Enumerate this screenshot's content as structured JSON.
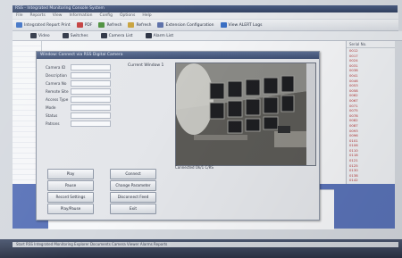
{
  "window": {
    "title": "RSS - Integrated Monitoring Console System"
  },
  "menu": [
    "File",
    "Reports",
    "View",
    "Information",
    "Config",
    "Options",
    "Help"
  ],
  "toolbar": [
    {
      "label": "Integrated Report Print",
      "icon": "print-icon",
      "color": "#3a6fc4"
    },
    {
      "label": "PDF",
      "icon": "pdf-icon",
      "color": "#c23b3b"
    },
    {
      "label": "Refresh",
      "icon": "refresh-icon",
      "color": "#4a8f3a"
    },
    {
      "label": "Refresh",
      "icon": "refresh-icon",
      "color": "#c8a23b"
    },
    {
      "label": "Extension Configuration",
      "icon": "settings-icon",
      "color": "#5b6fa8"
    },
    {
      "label": "View ALERT Logs",
      "icon": "log-icon",
      "color": "#3a6fc4"
    }
  ],
  "toolbar2": [
    {
      "label": "Video",
      "icon": "video-icon"
    },
    {
      "label": "Switches",
      "icon": "switch-icon"
    },
    {
      "label": "Camera List",
      "icon": "camera-icon"
    },
    {
      "label": "Alarm List",
      "icon": "alarm-icon"
    }
  ],
  "right_panel": {
    "header": "Serial No.",
    "ids": [
      "0012",
      "0017",
      "0024",
      "0031",
      "0038",
      "0041",
      "0046",
      "0053",
      "0058",
      "0062",
      "0067",
      "0071",
      "0075",
      "0078",
      "0082",
      "0087",
      "0093",
      "0096",
      "0101",
      "0106",
      "0110",
      "0118",
      "0121",
      "0125",
      "0130",
      "0138",
      "0142",
      "0147"
    ]
  },
  "dialog": {
    "title": "Window: Connect via RSS Digital Camera",
    "fields": [
      {
        "label": "Camera ID",
        "value": ""
      },
      {
        "label": "Description",
        "value": ""
      },
      {
        "label": "Camera No",
        "value": ""
      },
      {
        "label": "Remote Site",
        "value": ""
      },
      {
        "label": "Access Type",
        "value": ""
      },
      {
        "label": "Mode",
        "value": ""
      },
      {
        "label": "Status",
        "value": ""
      },
      {
        "label": "Patrons",
        "value": ""
      }
    ],
    "camera_label": "Current Window 1",
    "camera_caption": "Connected Ok/1  C/RS",
    "buttons_left": [
      "Play",
      "Pause",
      "Record Settings",
      "Play/Pause"
    ],
    "buttons_right": [
      "Connect",
      "Change Parameter",
      "Disconnect Feed",
      "Exit"
    ]
  },
  "taskbar": {
    "text": "Start   RSS Integrated Monitoring   Explorer   Documents   Camera Viewer   Alarms   Reports"
  }
}
